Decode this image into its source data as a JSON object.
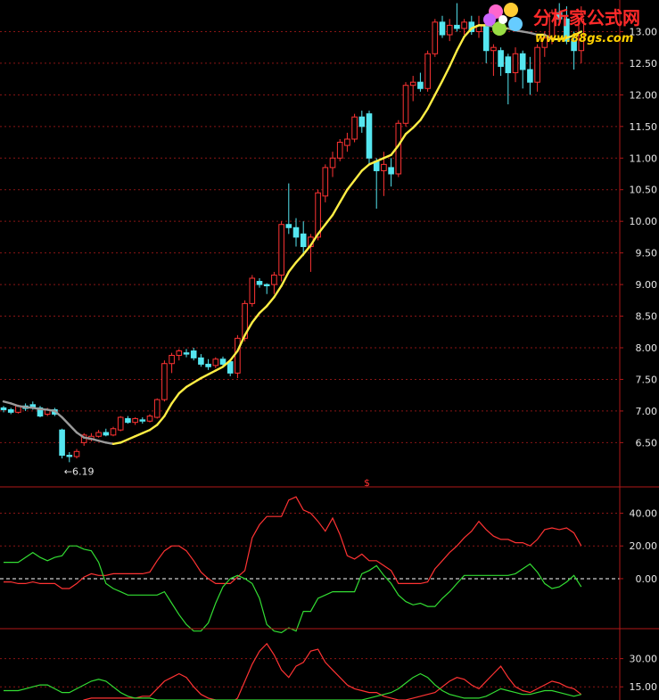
{
  "watermark": {
    "name": "分析家公式网",
    "url": "www.88gs.com"
  },
  "chart_data": [
    {
      "type": "candlestick",
      "ylim": [
        5.8,
        13.5
      ],
      "y_ticks": [
        "6.50",
        "7.00",
        "7.50",
        "8.00",
        "8.50",
        "9.00",
        "9.50",
        "10.00",
        "10.50",
        "11.00",
        "11.50",
        "12.00",
        "12.50",
        "13.00"
      ],
      "y_tick_values": [
        6.5,
        7.0,
        7.5,
        8.0,
        8.5,
        9.0,
        9.5,
        10.0,
        10.5,
        11.0,
        11.5,
        12.0,
        12.5,
        13.0
      ],
      "low_annotation": "←6.19",
      "low_value": 6.19,
      "up_color": "#ff3333",
      "down_color": "#55e6f0",
      "candles": [
        [
          7.05,
          7.08,
          6.98,
          7.02
        ],
        [
          7.02,
          7.05,
          6.95,
          6.98
        ],
        [
          6.98,
          7.1,
          6.96,
          7.08
        ],
        [
          7.08,
          7.12,
          7.0,
          7.04
        ],
        [
          7.1,
          7.15,
          7.02,
          7.05
        ],
        [
          7.05,
          7.08,
          6.9,
          6.92
        ],
        [
          6.95,
          7.05,
          6.92,
          7.02
        ],
        [
          7.02,
          7.05,
          6.92,
          6.95
        ],
        [
          6.7,
          6.72,
          6.25,
          6.3
        ],
        [
          6.3,
          6.35,
          6.19,
          6.28
        ],
        [
          6.28,
          6.4,
          6.25,
          6.36
        ],
        [
          6.5,
          6.65,
          6.45,
          6.62
        ],
        [
          6.55,
          6.65,
          6.52,
          6.6
        ],
        [
          6.6,
          6.7,
          6.58,
          6.66
        ],
        [
          6.66,
          6.72,
          6.6,
          6.62
        ],
        [
          6.62,
          6.75,
          6.6,
          6.72
        ],
        [
          6.7,
          6.92,
          6.68,
          6.9
        ],
        [
          6.88,
          6.92,
          6.8,
          6.82
        ],
        [
          6.82,
          6.9,
          6.78,
          6.88
        ],
        [
          6.86,
          6.9,
          6.8,
          6.84
        ],
        [
          6.84,
          6.95,
          6.82,
          6.92
        ],
        [
          6.9,
          7.2,
          6.88,
          7.18
        ],
        [
          7.18,
          7.8,
          7.15,
          7.75
        ],
        [
          7.75,
          7.92,
          7.6,
          7.88
        ],
        [
          7.88,
          7.98,
          7.8,
          7.95
        ],
        [
          7.92,
          7.98,
          7.85,
          7.9
        ],
        [
          7.95,
          8.0,
          7.8,
          7.84
        ],
        [
          7.84,
          7.9,
          7.7,
          7.74
        ],
        [
          7.74,
          7.82,
          7.65,
          7.7
        ],
        [
          7.72,
          7.85,
          7.68,
          7.82
        ],
        [
          7.82,
          7.86,
          7.7,
          7.74
        ],
        [
          7.78,
          7.82,
          7.55,
          7.6
        ],
        [
          7.6,
          8.2,
          7.52,
          8.15
        ],
        [
          8.15,
          8.75,
          8.1,
          8.7
        ],
        [
          8.7,
          9.15,
          8.65,
          9.1
        ],
        [
          9.05,
          9.1,
          8.95,
          9.0
        ],
        [
          9.0,
          9.02,
          8.85,
          8.98
        ],
        [
          9.0,
          9.2,
          8.85,
          9.15
        ],
        [
          9.15,
          10.0,
          9.05,
          9.95
        ],
        [
          9.95,
          10.6,
          9.8,
          9.9
        ],
        [
          9.9,
          10.05,
          9.6,
          9.75
        ],
        [
          9.8,
          10.0,
          9.45,
          9.6
        ],
        [
          9.6,
          9.8,
          9.2,
          9.75
        ],
        [
          9.75,
          10.5,
          9.7,
          10.45
        ],
        [
          10.4,
          10.9,
          10.3,
          10.85
        ],
        [
          10.85,
          11.1,
          10.7,
          11.0
        ],
        [
          11.0,
          11.3,
          10.95,
          11.25
        ],
        [
          11.2,
          11.4,
          11.1,
          11.3
        ],
        [
          11.3,
          11.7,
          11.25,
          11.65
        ],
        [
          11.65,
          11.75,
          11.4,
          11.5
        ],
        [
          11.7,
          11.75,
          10.9,
          11.0
        ],
        [
          10.95,
          11.0,
          10.2,
          10.8
        ],
        [
          10.8,
          11.1,
          10.4,
          10.9
        ],
        [
          10.85,
          11.0,
          10.55,
          10.75
        ],
        [
          10.75,
          11.6,
          10.7,
          11.55
        ],
        [
          11.55,
          12.2,
          11.5,
          12.15
        ],
        [
          12.15,
          12.3,
          11.9,
          12.2
        ],
        [
          12.2,
          12.35,
          12.05,
          12.1
        ],
        [
          12.1,
          12.7,
          12.05,
          12.65
        ],
        [
          12.65,
          13.2,
          12.6,
          13.15
        ],
        [
          13.15,
          13.25,
          12.9,
          12.95
        ],
        [
          12.95,
          13.2,
          12.85,
          13.1
        ],
        [
          13.1,
          13.45,
          13.0,
          13.05
        ],
        [
          13.05,
          13.2,
          12.95,
          13.15
        ],
        [
          13.15,
          13.25,
          12.95,
          13.0
        ],
        [
          13.0,
          13.25,
          12.9,
          13.1
        ],
        [
          13.1,
          13.2,
          12.5,
          12.7
        ],
        [
          12.7,
          12.8,
          12.3,
          12.75
        ],
        [
          12.7,
          12.75,
          12.3,
          12.45
        ],
        [
          12.6,
          12.65,
          11.85,
          12.35
        ],
        [
          12.35,
          12.75,
          12.2,
          12.65
        ],
        [
          12.65,
          12.7,
          12.1,
          12.4
        ],
        [
          12.4,
          12.6,
          12.0,
          12.2
        ],
        [
          12.2,
          12.8,
          12.05,
          12.75
        ],
        [
          12.75,
          13.0,
          12.6,
          12.9
        ],
        [
          12.9,
          13.35,
          12.8,
          13.3
        ],
        [
          13.3,
          13.45,
          13.1,
          13.2
        ],
        [
          13.2,
          13.4,
          12.8,
          12.85
        ],
        [
          12.85,
          13.0,
          12.4,
          12.7
        ],
        [
          12.7,
          13.4,
          12.5,
          13.2
        ]
      ],
      "ma_line": [
        7.15,
        7.12,
        7.08,
        7.06,
        7.05,
        7.03,
        7.02,
        7.0,
        6.9,
        6.78,
        6.66,
        6.58,
        6.56,
        6.53,
        6.5,
        6.48,
        6.5,
        6.55,
        6.6,
        6.65,
        6.7,
        6.78,
        6.92,
        7.12,
        7.28,
        7.38,
        7.45,
        7.52,
        7.58,
        7.64,
        7.7,
        7.8,
        7.95,
        8.2,
        8.4,
        8.55,
        8.66,
        8.8,
        8.98,
        9.2,
        9.35,
        9.48,
        9.62,
        9.8,
        9.95,
        10.1,
        10.3,
        10.5,
        10.65,
        10.8,
        10.9,
        10.95,
        11.0,
        11.05,
        11.2,
        11.38,
        11.48,
        11.6,
        11.78,
        12.0,
        12.22,
        12.45,
        12.7,
        12.92,
        13.05,
        13.1,
        13.1,
        13.08,
        13.05,
        13.05,
        13.02,
        13.0,
        12.98,
        12.95,
        12.95,
        12.88,
        12.88,
        12.9,
        12.94,
        13.0
      ],
      "ma_bull_color": "#ffee44",
      "ma_bear_color": "#9a9a9a"
    },
    {
      "type": "line",
      "ylim": [
        -30,
        55
      ],
      "y_ticks": [
        "40.00",
        "20.00",
        "0.00"
      ],
      "y_tick_values": [
        40,
        20,
        0
      ],
      "zero_line": true,
      "marker_text": "$",
      "series": [
        {
          "color": "#ff3333",
          "values": [
            -2,
            -2,
            -3,
            -3,
            -2,
            -3,
            -3,
            -3,
            -6,
            -6,
            -3,
            1,
            3,
            2,
            2,
            3,
            3,
            3,
            3,
            3,
            4,
            11,
            17,
            20,
            20,
            17,
            11,
            4,
            0,
            -3,
            -3,
            -3,
            1,
            5,
            25,
            33,
            38,
            38,
            38,
            48,
            50,
            42,
            40,
            35,
            29,
            37,
            27,
            14,
            12,
            15,
            11,
            11,
            8,
            5,
            -3,
            -3,
            -3,
            -3,
            -2,
            6,
            11,
            16,
            20,
            25,
            29,
            35,
            30,
            26,
            24,
            24,
            22,
            22,
            20,
            24,
            30,
            31,
            30,
            31,
            28,
            20
          ]
        },
        {
          "color": "#33dd33",
          "values": [
            10,
            10,
            10,
            13,
            16,
            13,
            11,
            13,
            14,
            20,
            20,
            18,
            17,
            10,
            -3,
            -6,
            -8,
            -10,
            -10,
            -10,
            -10,
            -10,
            -8,
            -15,
            -22,
            -28,
            -32,
            -32,
            -27,
            -15,
            -5,
            0,
            2,
            0,
            -3,
            -12,
            -28,
            -32,
            -33,
            -30,
            -32,
            -20,
            -20,
            -12,
            -10,
            -8,
            -8,
            -8,
            -8,
            3,
            5,
            8,
            2,
            -3,
            -10,
            -14,
            -16,
            -15,
            -17,
            -17,
            -12,
            -8,
            -3,
            2,
            2,
            2,
            2,
            2,
            2,
            2,
            3,
            6,
            9,
            4,
            -3,
            -6,
            -5,
            -2,
            2,
            -5
          ]
        }
      ]
    },
    {
      "type": "line",
      "ylim": [
        8,
        45
      ],
      "y_ticks": [
        "30.00",
        "15.00"
      ],
      "y_tick_values": [
        30,
        15
      ],
      "series": [
        {
          "color": "#ff3333",
          "values": [
            5,
            5,
            6,
            6,
            5,
            6,
            6,
            6,
            5,
            5,
            6,
            8,
            9,
            9,
            9,
            9,
            9,
            9,
            9,
            10,
            10,
            14,
            18,
            20,
            22,
            20,
            15,
            11,
            9,
            8,
            7,
            6,
            9,
            18,
            27,
            34,
            38,
            32,
            24,
            20,
            26,
            28,
            34,
            35,
            28,
            24,
            20,
            16,
            14,
            13,
            12,
            12,
            10,
            9,
            8,
            8,
            9,
            10,
            11,
            12,
            15,
            18,
            20,
            19,
            16,
            14,
            18,
            22,
            26,
            20,
            15,
            13,
            12,
            14,
            16,
            18,
            17,
            15,
            14,
            11
          ]
        },
        {
          "color": "#33dd33",
          "values": [
            13,
            13,
            13,
            14,
            15,
            16,
            16,
            14,
            12,
            12,
            14,
            16,
            18,
            19,
            18,
            15,
            12,
            10,
            9,
            9,
            9,
            8,
            8,
            8,
            8,
            8,
            8,
            8,
            8,
            8,
            8,
            8,
            8,
            8,
            8,
            8,
            8,
            8,
            8,
            8,
            8,
            8,
            8,
            8,
            8,
            8,
            8,
            8,
            8,
            8,
            9,
            10,
            11,
            12,
            14,
            17,
            20,
            22,
            20,
            16,
            13,
            11,
            10,
            9,
            9,
            9,
            10,
            12,
            14,
            13,
            12,
            11,
            11,
            12,
            13,
            13,
            12,
            11,
            10,
            11
          ]
        }
      ]
    }
  ]
}
